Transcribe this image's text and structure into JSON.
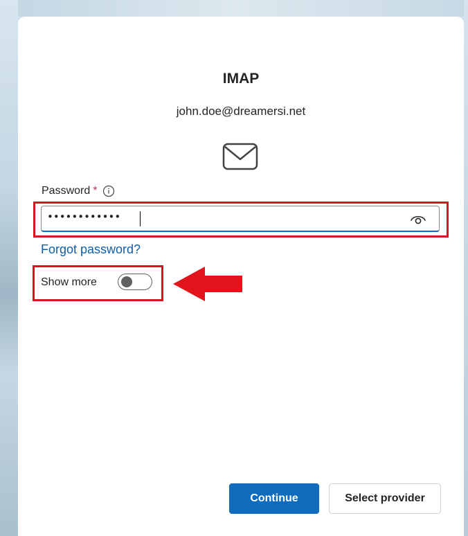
{
  "dialog": {
    "title": "IMAP",
    "email": "john.doe@dreamersi.net"
  },
  "password": {
    "label": "Password",
    "required_mark": "*",
    "value_masked": "••••••••••••"
  },
  "forgot_link": "Forgot password?",
  "show_more": {
    "label": "Show more",
    "toggle_on": false
  },
  "buttons": {
    "continue": "Continue",
    "select_provider": "Select provider"
  },
  "colors": {
    "accent": "#0f6cbd",
    "link": "#115ea3",
    "annotation": "#d4151f",
    "required": "#c4314b"
  },
  "icons": [
    "mail-icon",
    "info-icon",
    "eye-icon",
    "red-arrow-left"
  ]
}
